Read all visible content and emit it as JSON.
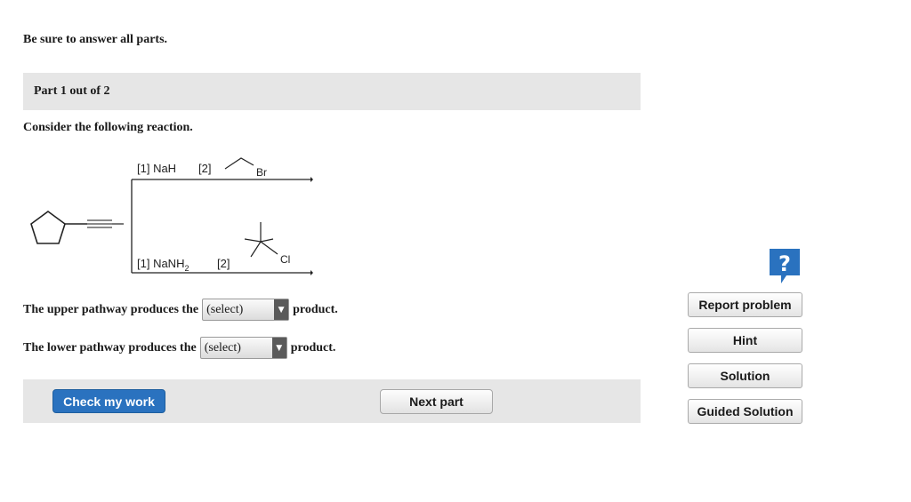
{
  "instruction": "Be sure to answer all parts.",
  "part": {
    "label": "Part 1 out of 2"
  },
  "question": "Consider the following reaction.",
  "reaction": {
    "upper_reagents": {
      "step1": "[1] NaH",
      "step2": "[2]",
      "halide": "Br"
    },
    "lower_reagents": {
      "step1": "[1] NaNH",
      "step1_subscript": "2",
      "step2": "[2]",
      "halide": "Cl"
    }
  },
  "questions": {
    "upper": {
      "prefix": "The upper pathway produces the",
      "select": "(select)",
      "suffix": "product."
    },
    "lower": {
      "prefix": "The lower pathway produces the",
      "select": "(select)",
      "suffix": "product."
    }
  },
  "actions": {
    "check": "Check my work",
    "next": "Next part"
  },
  "sidebar": {
    "help_icon_glyph": "?",
    "report": "Report problem",
    "hint": "Hint",
    "solution": "Solution",
    "guided": "Guided Solution"
  },
  "colors": {
    "primary_button": "#2a72bf",
    "help_icon": "#2a72bf",
    "panel_bg": "#e6e6e6"
  },
  "icons": {
    "dropdown": "triangle-down-icon",
    "help": "help-question-icon"
  }
}
